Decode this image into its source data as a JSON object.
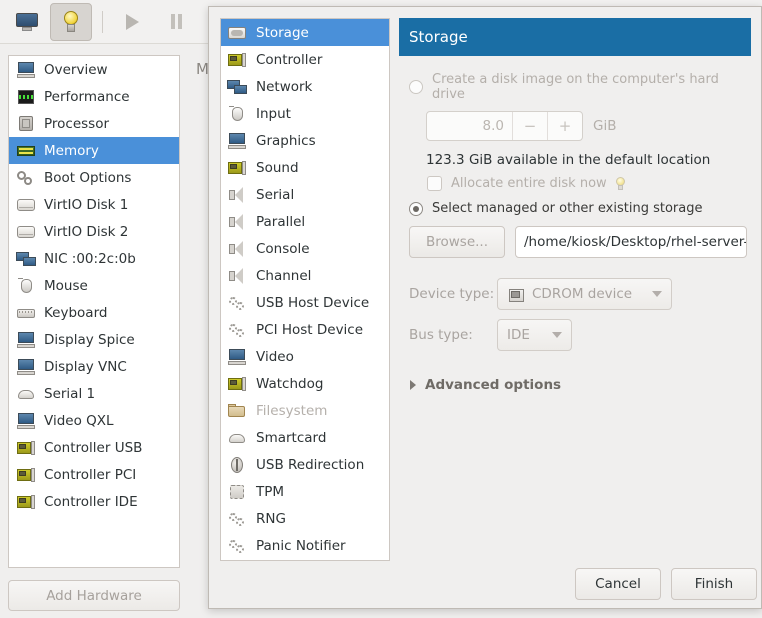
{
  "toolbar": {
    "buttons": [
      {
        "name": "console-view",
        "icon": "monitor-icon",
        "active": false
      },
      {
        "name": "details-view",
        "icon": "lightbulb-icon",
        "active": true
      },
      {
        "name": "run",
        "icon": "play-icon",
        "active": false
      },
      {
        "name": "pause",
        "icon": "pause-icon",
        "active": false
      },
      {
        "name": "shutdown",
        "icon": "vm-box-icon",
        "active": false
      }
    ]
  },
  "background_window": {
    "detail_heading_partial": "M",
    "hardware_list": [
      {
        "label": "Overview",
        "icon": "computer-icon",
        "selected": false
      },
      {
        "label": "Performance",
        "icon": "performance-graph-icon",
        "selected": false
      },
      {
        "label": "Processor",
        "icon": "cpu-icon",
        "selected": false
      },
      {
        "label": "Memory",
        "icon": "memory-module-icon",
        "selected": true
      },
      {
        "label": "Boot Options",
        "icon": "gears-icon",
        "selected": false
      },
      {
        "label": "VirtIO Disk 1",
        "icon": "disk-icon",
        "selected": false
      },
      {
        "label": "VirtIO Disk 2",
        "icon": "disk-icon",
        "selected": false
      },
      {
        "label": "NIC :00:2c:0b",
        "icon": "network-card-icon",
        "selected": false
      },
      {
        "label": "Mouse",
        "icon": "mouse-icon",
        "selected": false
      },
      {
        "label": "Keyboard",
        "icon": "keyboard-icon",
        "selected": false
      },
      {
        "label": "Display Spice",
        "icon": "display-icon",
        "selected": false
      },
      {
        "label": "Display VNC",
        "icon": "display-icon",
        "selected": false
      },
      {
        "label": "Serial 1",
        "icon": "serial-port-icon",
        "selected": false
      },
      {
        "label": "Video QXL",
        "icon": "display-icon",
        "selected": false
      },
      {
        "label": "Controller USB",
        "icon": "controller-card-icon",
        "selected": false
      },
      {
        "label": "Controller PCI",
        "icon": "controller-card-icon",
        "selected": false
      },
      {
        "label": "Controller IDE",
        "icon": "controller-card-icon",
        "selected": false
      }
    ],
    "add_hardware_label": "Add Hardware"
  },
  "dialog": {
    "device_list": [
      {
        "label": "Storage",
        "icon": "storage-icon",
        "selected": true,
        "disabled": false
      },
      {
        "label": "Controller",
        "icon": "controller-card-icon",
        "selected": false,
        "disabled": false
      },
      {
        "label": "Network",
        "icon": "network-card-icon",
        "selected": false,
        "disabled": false
      },
      {
        "label": "Input",
        "icon": "mouse-icon",
        "selected": false,
        "disabled": false
      },
      {
        "label": "Graphics",
        "icon": "display-icon",
        "selected": false,
        "disabled": false
      },
      {
        "label": "Sound",
        "icon": "sound-card-icon",
        "selected": false,
        "disabled": false
      },
      {
        "label": "Serial",
        "icon": "speaker-port-icon",
        "selected": false,
        "disabled": false
      },
      {
        "label": "Parallel",
        "icon": "speaker-port-icon",
        "selected": false,
        "disabled": false
      },
      {
        "label": "Console",
        "icon": "speaker-port-icon",
        "selected": false,
        "disabled": false
      },
      {
        "label": "Channel",
        "icon": "speaker-port-icon",
        "selected": false,
        "disabled": false
      },
      {
        "label": "USB Host Device",
        "icon": "cogs-icon",
        "selected": false,
        "disabled": false
      },
      {
        "label": "PCI Host Device",
        "icon": "cogs-icon",
        "selected": false,
        "disabled": false
      },
      {
        "label": "Video",
        "icon": "display-icon",
        "selected": false,
        "disabled": false
      },
      {
        "label": "Watchdog",
        "icon": "controller-card-icon",
        "selected": false,
        "disabled": false
      },
      {
        "label": "Filesystem",
        "icon": "folder-icon",
        "selected": false,
        "disabled": true
      },
      {
        "label": "Smartcard",
        "icon": "serial-port-icon",
        "selected": false,
        "disabled": false
      },
      {
        "label": "USB Redirection",
        "icon": "usb-icon",
        "selected": false,
        "disabled": false
      },
      {
        "label": "TPM",
        "icon": "tpm-chip-icon",
        "selected": false,
        "disabled": false
      },
      {
        "label": "RNG",
        "icon": "cogs-icon",
        "selected": false,
        "disabled": false
      },
      {
        "label": "Panic Notifier",
        "icon": "cogs-icon",
        "selected": false,
        "disabled": false
      }
    ],
    "header_title": "Storage",
    "storage": {
      "create_disk_radio_label": "Create a disk image on the computer's hard drive",
      "create_disk_selected": false,
      "size_value": "8.0",
      "size_minus_label": "−",
      "size_plus_label": "+",
      "size_unit": "GiB",
      "available_text": "123.3 GiB available in the default location",
      "allocate_checkbox_label": "Allocate entire disk now",
      "allocate_checked": false,
      "select_existing_radio_label": "Select managed or other existing storage",
      "select_existing_selected": true,
      "browse_label": "Browse...",
      "path_value": "/home/kiosk/Desktop/rhel-server-",
      "device_type_label": "Device type:",
      "device_type_value": "CDROM device",
      "bus_type_label": "Bus type:",
      "bus_type_value": "IDE",
      "advanced_options_label": "Advanced options"
    },
    "footer": {
      "cancel_label": "Cancel",
      "finish_label": "Finish"
    }
  },
  "colors": {
    "selection_blue": "#4a90d9",
    "header_blue": "#1a6ea5",
    "window_bg": "#f0efee",
    "list_bg": "#ffffff"
  }
}
